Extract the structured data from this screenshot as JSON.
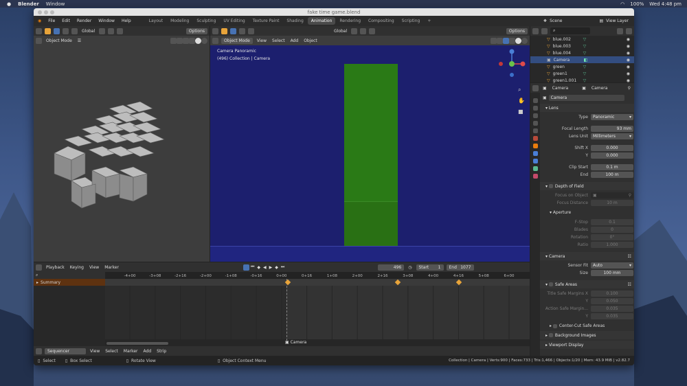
{
  "mac_menubar": {
    "app": "Blender",
    "menu": "Window",
    "status": "100%",
    "clock": "Wed 4:48 pm"
  },
  "window": {
    "title": "fake time game.blend"
  },
  "topbar": {
    "menus": [
      "File",
      "Edit",
      "Render",
      "Window",
      "Help"
    ],
    "workspaces": [
      "Layout",
      "Modeling",
      "Sculpting",
      "UV Editing",
      "Texture Paint",
      "Shading",
      "Animation",
      "Rendering",
      "Compositing",
      "Scripting"
    ],
    "active_workspace": "Animation",
    "scene": "Scene",
    "view_layer": "View Layer"
  },
  "left_viewport": {
    "orientation": "Global",
    "options": "Options",
    "mode": "Object Mode"
  },
  "camera_viewport": {
    "orientation": "Global",
    "options": "Options",
    "mode": "Object Mode",
    "menus": [
      "View",
      "Select",
      "Add",
      "Object"
    ],
    "info_line1": "Camera Panoramic",
    "info_line2": "(496) Collection | Camera"
  },
  "timeline": {
    "menus": [
      "Playback",
      "Keying",
      "View",
      "Marker"
    ],
    "current_frame": "496",
    "start_label": "Start",
    "start_value": "1",
    "end_label": "End",
    "end_value": "1077",
    "summary": "Summary",
    "ticks": [
      "-4+00",
      "-3+08",
      "-2+16",
      "-2+00",
      "-1+08",
      "-0+16",
      "0+00",
      "0+16",
      "1+08",
      "2+00",
      "2+16",
      "3+08",
      "4+00",
      "4+16",
      "5+08",
      "6+00"
    ],
    "marker": "Camera"
  },
  "sequencer": {
    "editor": "Sequencer",
    "menus": [
      "View",
      "Select",
      "Marker",
      "Add",
      "Strip"
    ]
  },
  "statusbar": {
    "select": "Select",
    "box_select": "Box Select",
    "rotate_view": "Rotate View",
    "context_menu": "Object Context Menu",
    "stats": "Collection | Camera | Verts:900 | Faces:733 | Tris:1,466 | Objects:1/20 | Mem: 43.9 MiB | v2.82.7"
  },
  "outliner": {
    "items": [
      {
        "name": "blue.002",
        "selected": false
      },
      {
        "name": "blue.003",
        "selected": false
      },
      {
        "name": "blue.004",
        "selected": false
      },
      {
        "name": "Camera",
        "selected": true
      },
      {
        "name": "green",
        "selected": false
      },
      {
        "name": "green1",
        "selected": false
      },
      {
        "name": "green1.001",
        "selected": false
      }
    ]
  },
  "properties": {
    "object_name": "Camera",
    "data_name": "Camera",
    "datablock": "Camera",
    "lens_section": "Lens",
    "type_label": "Type",
    "type_value": "Panoramic",
    "focal_label": "Focal Length",
    "focal_value": "93 mm",
    "lens_unit_label": "Lens Unit",
    "lens_unit_value": "Millimeters",
    "shift_x_label": "Shift X",
    "shift_x_value": "0.000",
    "shift_y_label": "Y",
    "shift_y_value": "0.000",
    "clip_start_label": "Clip Start",
    "clip_start_value": "0.1 m",
    "clip_end_label": "End",
    "clip_end_value": "100 m",
    "dof_section": "Depth of Field",
    "focus_object_label": "Focus on Object",
    "focus_distance_label": "Focus Distance",
    "focus_distance_value": "10 m",
    "aperture_section": "Aperture",
    "fstop_label": "F-Stop",
    "fstop_value": "0.1",
    "blades_label": "Blades",
    "blades_value": "0",
    "rotation_label": "Rotation",
    "rotation_value": "0°",
    "ratio_label": "Ratio",
    "ratio_value": "1.000",
    "camera_section": "Camera",
    "sensor_fit_label": "Sensor Fit",
    "sensor_fit_value": "Auto",
    "size_label": "Size",
    "size_value": "100 mm",
    "safe_areas_section": "Safe Areas",
    "title_safe_label": "Title Safe Margins X",
    "title_safe_x": "0.100",
    "title_safe_y_label": "Y",
    "title_safe_y": "0.050",
    "action_safe_label": "Action Safe Margin...",
    "action_safe_x": "0.035",
    "action_safe_y_label": "Y",
    "action_safe_y": "0.035",
    "center_cut": "Center-Cut Safe Areas",
    "background_images": "Background Images",
    "viewport_display": "Viewport Display"
  },
  "colors": {
    "accent_blue": "#4772b3",
    "selected_row": "#334d80",
    "camera_bg": "#1c1f6e",
    "green_object": "#2a7a16",
    "keyframe": "#e8a43a"
  }
}
